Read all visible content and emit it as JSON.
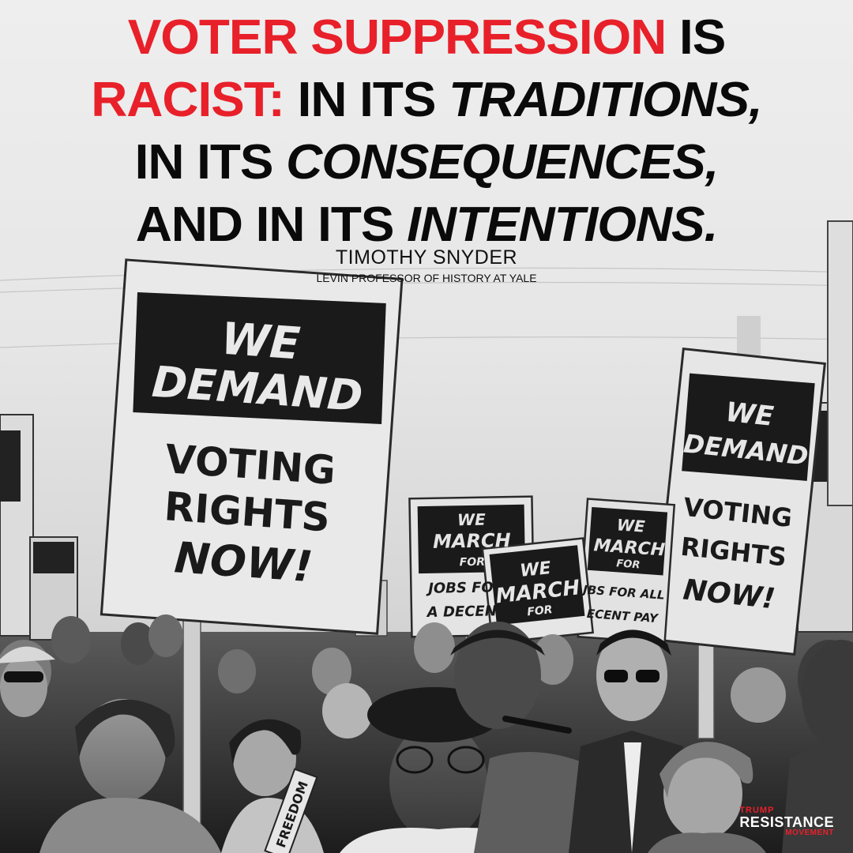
{
  "headline": {
    "line1_red": "VOTER SUPPRESSION",
    "line1_black": "IS",
    "line2_red": "RACIST:",
    "line2_black": "IN ITS",
    "line2_italic": "TRADITIONS,",
    "line3_black": "IN ITS",
    "line3_italic": "CONSEQUENCES,",
    "line4_black": "AND IN ITS",
    "line4_italic": "INTENTIONS."
  },
  "attribution": {
    "name": "TIMOTHY SNYDER",
    "role": "LEVIN PROFESSOR OF HISTORY AT YALE"
  },
  "signs": {
    "left_big": {
      "banner": [
        "WE",
        "DEMAND"
      ],
      "body": [
        "VOTING",
        "RIGHTS",
        "NOW!"
      ]
    },
    "right_big": {
      "banner": [
        "WE",
        "DEMAND"
      ],
      "body": [
        "VOTING",
        "RIGHTS",
        "NOW!"
      ]
    },
    "march_1": {
      "banner": [
        "WE",
        "MARCH",
        "FOR"
      ],
      "body": [
        "JOBS FOR",
        "A DECENT"
      ]
    },
    "march_2": {
      "banner": [
        "WE",
        "MARCH",
        "FOR"
      ]
    },
    "march_3": {
      "banner": [
        "WE",
        "MARCH",
        "FOR"
      ],
      "body": [
        "JBS FOR ALL",
        "ECENT PAY"
      ]
    },
    "freedom": "FREEDOM"
  },
  "logo": {
    "line1": "TRUMP",
    "line2": "RESISTANCE",
    "line3": "MOVEMENT"
  },
  "colors": {
    "accent_red": "#e8202a",
    "text_black": "#0a0a0a"
  }
}
